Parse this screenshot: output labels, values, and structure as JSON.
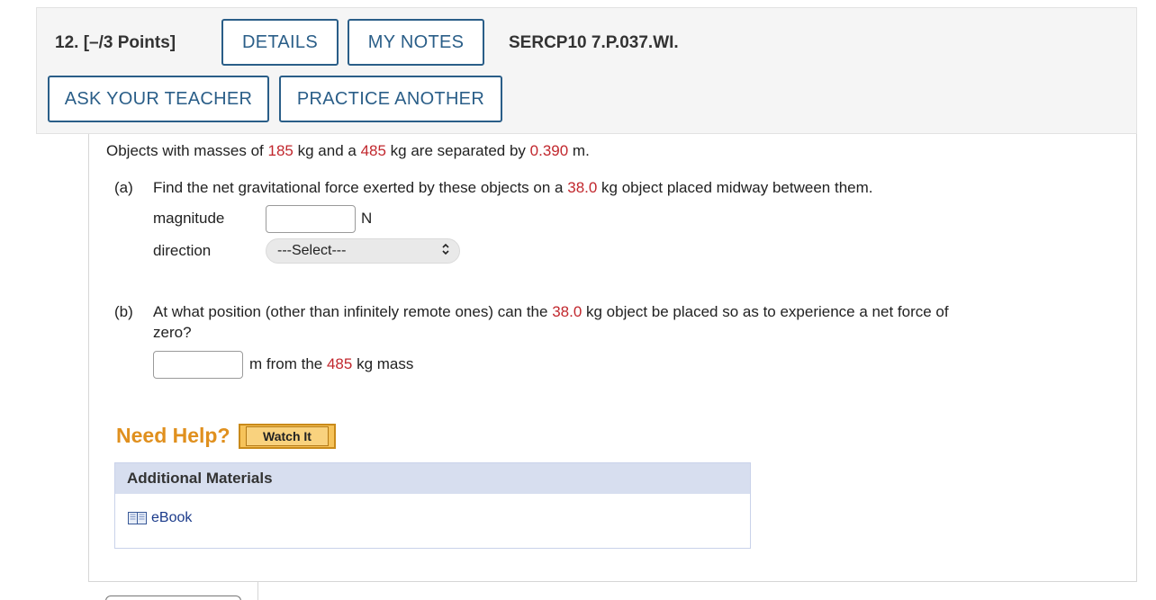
{
  "header": {
    "question_number": "12.",
    "points": "[–/3 Points]",
    "details_label": "DETAILS",
    "my_notes_label": "MY NOTES",
    "problem_code": "SERCP10 7.P.037.WI.",
    "ask_teacher_label": "ASK YOUR TEACHER",
    "practice_another_label": "PRACTICE ANOTHER"
  },
  "problem": {
    "intro": {
      "p1": "Objects with masses of ",
      "m1": "185",
      "p2": " kg and a ",
      "m2": "485",
      "p3": " kg are separated by ",
      "d": "0.390",
      "p4": " m."
    },
    "part_a": {
      "label": "(a)",
      "text1": "Find the net gravitational force exerted by these objects on a ",
      "mass": "38.0",
      "text2": " kg object placed midway between them.",
      "magnitude_label": "magnitude",
      "magnitude_value": "",
      "magnitude_unit": "N",
      "direction_label": "direction",
      "direction_selected": "---Select---"
    },
    "part_b": {
      "label": "(b)",
      "text1": "At what position (other than infinitely remote ones) can the ",
      "mass": "38.0",
      "text2": " kg object be placed so as to experience a net force of",
      "text3": "zero?",
      "answer_value": "",
      "after1": "m from the ",
      "after_mass": "485",
      "after2": " kg mass"
    }
  },
  "help": {
    "need_help_label": "Need Help?",
    "watch_it_label": "Watch It"
  },
  "additional_materials": {
    "title": "Additional Materials",
    "ebook_label": "eBook"
  },
  "colors": {
    "accent_blue": "#2a5e88",
    "value_red": "#c1272d",
    "need_help_orange": "#e0901e"
  }
}
